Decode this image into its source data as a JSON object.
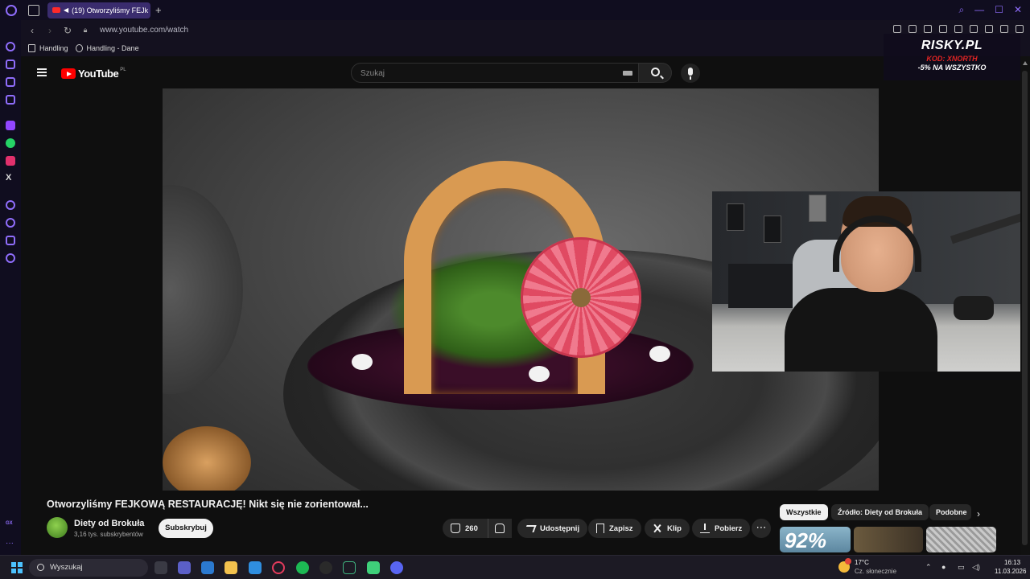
{
  "browser": {
    "tab_title": "(19) Otworzyliśmy FEJk",
    "url": "www.youtube.com/watch",
    "bookmarks": [
      "Handling",
      "Handling - Dane"
    ],
    "accent_color": "#8f6dfb"
  },
  "youtube": {
    "logo_text": "YouTube",
    "region": "PL",
    "search_placeholder": "Szukaj"
  },
  "overlay": {
    "brand": "RISKY.PL",
    "code": "KOD: XNORTH",
    "promo": "-5% NA WSZYSTKO"
  },
  "video": {
    "title": "Otworzyliśmy FEJKOWĄ RESTAURACJĘ! Nikt się nie zorientował...",
    "channel_name": "Diety od Brokuła",
    "subscribers": "3,16 tys. subskrybentów",
    "subscribe_label": "Subskrybuj",
    "like_count": "260",
    "share_label": "Udostępnij",
    "save_label": "Zapisz",
    "clip_label": "Klip",
    "download_label": "Pobierz"
  },
  "chips": [
    "Wszystkie",
    "Źródło: Diety od Brokuła",
    "Podobne"
  ],
  "thumb_text": "92%",
  "taskbar": {
    "search_label": "Wyszukaj",
    "weather_temp": "17°C",
    "weather_condition": "Cz. słonecznie",
    "time": "16:13",
    "date": "11.03.2026",
    "notification_count": "1"
  }
}
